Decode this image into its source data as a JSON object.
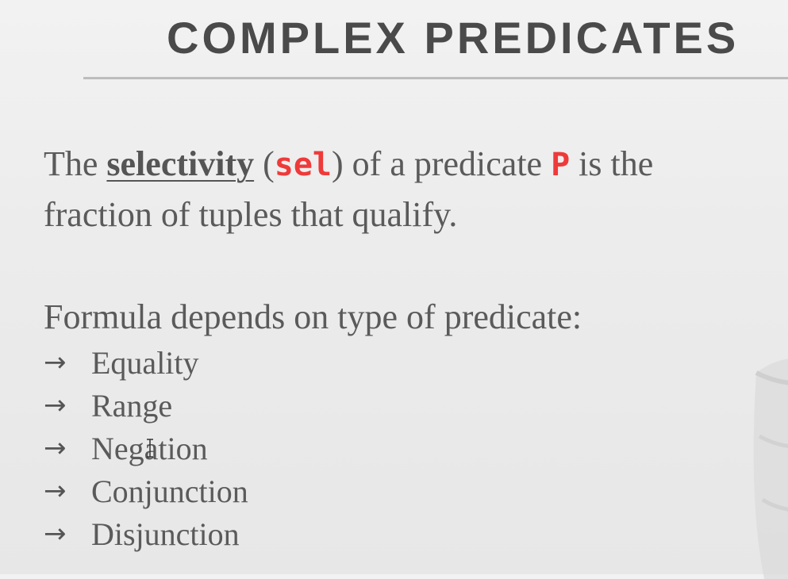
{
  "slide": {
    "title": "COMPLEX PREDICATES",
    "definition": {
      "prefix": "The",
      "term": "selectivity",
      "open_paren": "(",
      "abbr": "sel",
      "close_paren": ")",
      "middle": "of a predicate",
      "variable": "P",
      "suffix": "is the",
      "line2": "fraction of tuples that qualify."
    },
    "formula_intro": "Formula depends on type of predicate:",
    "arrow": "→",
    "list": [
      "Equality",
      "Range",
      "Negation",
      "Conjunction",
      "Disjunction"
    ]
  },
  "colors": {
    "accent_red": "#ef3a3a",
    "text_gray": "#5a5a5a",
    "title_gray": "#4a4a4a"
  }
}
